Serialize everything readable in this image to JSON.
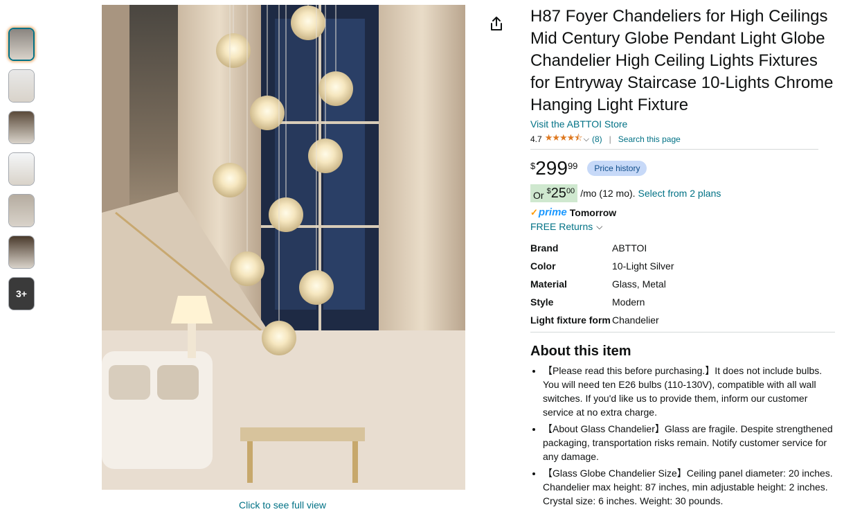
{
  "thumbnails": [
    {
      "name": "thumb-image-1",
      "tone": "#8a8580"
    },
    {
      "name": "thumb-image-2",
      "tone": "#e8e8e8"
    },
    {
      "name": "thumb-image-3",
      "tone": "#5a4a3a"
    },
    {
      "name": "thumb-image-4",
      "tone": "#f4f6f8"
    },
    {
      "name": "thumb-image-5",
      "tone": "#b5aca0"
    },
    {
      "name": "thumb-image-6",
      "tone": "#4a3a2c"
    }
  ],
  "more_thumbs_label": "3+",
  "main_image_caption": "Click to see full view",
  "share_icon": "share-icon",
  "product": {
    "title": "H87 Foyer Chandeliers for High Ceilings Mid Century Globe Pendant Light Globe Chandelier High Ceiling Lights Fixtures for Entryway Staircase 10-Lights Chrome Hanging Light Fixture",
    "store_link": "Visit the ABTTOI Store",
    "rating": "4.7",
    "rating_value": 4.7,
    "stars": "★★★★⯪",
    "review_count": "(8)",
    "search_page": "Search this page",
    "divider": "|"
  },
  "price": {
    "symbol": "$",
    "whole": "299",
    "fraction": "99",
    "history_button": "Price history"
  },
  "monthly": {
    "prefix": "Or",
    "symbol": "$",
    "whole": "25",
    "fraction": "00",
    "term": "/mo (12 mo).",
    "plans_link": "Select from 2 plans"
  },
  "delivery": {
    "prime_label": "prime",
    "when": "Tomorrow",
    "returns": "FREE Returns"
  },
  "specs": [
    {
      "key": "Brand",
      "value": "ABTTOI"
    },
    {
      "key": "Color",
      "value": "10-Light Silver"
    },
    {
      "key": "Material",
      "value": "Glass, Metal"
    },
    {
      "key": "Style",
      "value": "Modern"
    },
    {
      "key": "Light fixture form",
      "value": "Chandelier"
    }
  ],
  "about": {
    "title": "About this item",
    "bullets": [
      "【Please read this before purchasing.】It does not include bulbs. You will need ten E26 bulbs (110-130V), compatible with all wall switches. If you'd like us to provide them, inform our customer service at no extra charge.",
      "【About Glass Chandelier】Glass are fragile. Despite strengthened packaging, transportation risks remain. Notify customer service for any damage.",
      "【Glass Globe Chandelier Size】Ceiling panel diameter: 20 inches. Chandelier max height: 87 inches, min adjustable height: 2 inches. Crystal size: 6 inches. Weight: 30 pounds."
    ]
  },
  "colors": {
    "link": "#007185",
    "star": "#de7921",
    "prime_blue": "#1a98ff",
    "price_history_bg": "#c7d9f8"
  }
}
